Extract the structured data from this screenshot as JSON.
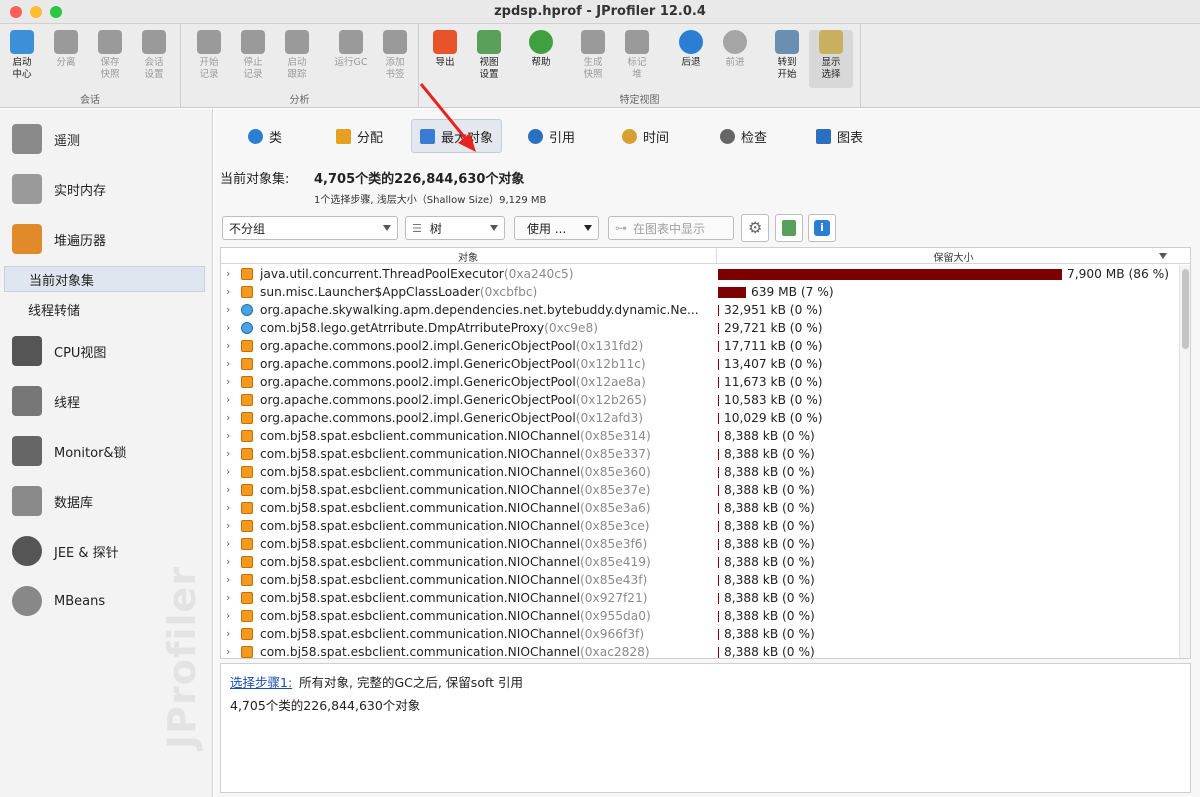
{
  "window": {
    "title": "zpdsp.hprof - JProfiler 12.0.4"
  },
  "toolbar": {
    "groups": [
      {
        "label": "会话",
        "buttons": [
          {
            "label": "启动\n中心",
            "icon": "launch-center-icon",
            "enabled": true
          },
          {
            "label": "分离",
            "icon": "detach-icon",
            "enabled": false
          },
          {
            "label": "保存\n快照",
            "icon": "save-snapshot-icon",
            "enabled": false
          },
          {
            "label": "会话\n设置",
            "icon": "session-settings-icon",
            "enabled": false
          }
        ]
      },
      {
        "label": "分析",
        "buttons": [
          {
            "label": "开始\n记录",
            "icon": "start-recording-icon",
            "enabled": false
          },
          {
            "label": "停止\n记录",
            "icon": "stop-recording-icon",
            "enabled": false
          },
          {
            "label": "启动\n跟踪",
            "icon": "start-tracking-icon",
            "enabled": false
          },
          {
            "label": "运行GC",
            "icon": "run-gc-icon",
            "enabled": false
          },
          {
            "label": "添加\n书签",
            "icon": "add-bookmark-icon",
            "enabled": false
          }
        ]
      },
      {
        "label": "特定视图",
        "buttons": [
          {
            "label": "导出",
            "icon": "export-icon",
            "enabled": true
          },
          {
            "label": "视图\n设置",
            "icon": "view-settings-icon",
            "enabled": true
          },
          {
            "label": "帮助",
            "icon": "help-icon",
            "enabled": true
          },
          {
            "label": "生成\n快照",
            "icon": "take-snapshot-icon",
            "enabled": false
          },
          {
            "label": "标记\n堆",
            "icon": "mark-heap-icon",
            "enabled": false
          },
          {
            "label": "后退",
            "icon": "back-icon",
            "enabled": true
          },
          {
            "label": "前进",
            "icon": "forward-icon",
            "enabled": false
          },
          {
            "label": "转到\n开始",
            "icon": "go-home-icon",
            "enabled": true
          },
          {
            "label": "显示\n选择",
            "icon": "show-selection-icon",
            "enabled": true,
            "selected": true
          }
        ]
      }
    ]
  },
  "sidebar": {
    "items": [
      {
        "label": "遥测",
        "icon": "telemetry-icon"
      },
      {
        "label": "实时内存",
        "icon": "live-memory-icon"
      },
      {
        "label": "堆遍历器",
        "icon": "heap-walker-icon"
      },
      {
        "label": "当前对象集",
        "sub": true,
        "selected": true
      },
      {
        "label": "线程转储",
        "sub": true
      },
      {
        "label": "CPU视图",
        "icon": "cpu-views-icon"
      },
      {
        "label": "线程",
        "icon": "threads-icon"
      },
      {
        "label": "Monitor&锁",
        "icon": "monitor-lock-icon"
      },
      {
        "label": "数据库",
        "icon": "database-icon"
      },
      {
        "label": "JEE & 探针",
        "icon": "jee-probes-icon"
      },
      {
        "label": "MBeans",
        "icon": "mbeans-icon"
      }
    ],
    "watermark": "JProfiler"
  },
  "tabs": [
    {
      "label": "类",
      "icon": "class-icon",
      "color": "#2a7fd4"
    },
    {
      "label": "分配",
      "icon": "allocations-icon",
      "color": "#e8a020"
    },
    {
      "label": "最大对象",
      "icon": "biggest-objects-icon",
      "color": "#3a7bd5",
      "selected": true
    },
    {
      "label": "引用",
      "icon": "references-icon",
      "color": "#2a6fc0"
    },
    {
      "label": "时间",
      "icon": "time-icon",
      "color": "#d8a030"
    },
    {
      "label": "检查",
      "icon": "inspections-icon",
      "color": "#666666"
    },
    {
      "label": "图表",
      "icon": "graph-icon",
      "color": "#2a6fc0"
    }
  ],
  "summary": {
    "label": "当前对象集:",
    "value": "4,705个类的226,844,630个对象",
    "sub": "1个选择步骤, 浅层大小（Shallow Size）9,129 MB"
  },
  "controls": {
    "grouping": "不分组",
    "view_mode": "树",
    "use_button": "使用 ...",
    "show_in_graph": "在图表中显示"
  },
  "table": {
    "columns": [
      "对象",
      "保留大小"
    ],
    "rows": [
      {
        "name": "java.util.concurrent.ThreadPoolExecutor",
        "addr": "(0xa240c5)",
        "size": "7,900 MB (86 %)",
        "pct": 0.86,
        "kind": "object"
      },
      {
        "name": "sun.misc.Launcher$AppClassLoader",
        "addr": "(0xcbfbc)",
        "size": "639 MB (7 %)",
        "pct": 0.07,
        "kind": "object"
      },
      {
        "name": "org.apache.skywalking.apm.dependencies.net.bytebuddy.dynamic.Ne...",
        "addr": "",
        "size": "32,951 kB (0 %)",
        "pct": 0.0036,
        "kind": "class"
      },
      {
        "name": "com.bj58.lego.getAtrribute.DmpAtrributeProxy",
        "addr": "(0xc9e8)",
        "size": "29,721 kB (0 %)",
        "pct": 0.0032,
        "kind": "class"
      },
      {
        "name": "org.apache.commons.pool2.impl.GenericObjectPool",
        "addr": "(0x131fd2)",
        "size": "17,711 kB (0 %)",
        "pct": 0.0019,
        "kind": "object"
      },
      {
        "name": "org.apache.commons.pool2.impl.GenericObjectPool",
        "addr": "(0x12b11c)",
        "size": "13,407 kB (0 %)",
        "pct": 0.0015,
        "kind": "object"
      },
      {
        "name": "org.apache.commons.pool2.impl.GenericObjectPool",
        "addr": "(0x12ae8a)",
        "size": "11,673 kB (0 %)",
        "pct": 0.0013,
        "kind": "object"
      },
      {
        "name": "org.apache.commons.pool2.impl.GenericObjectPool",
        "addr": "(0x12b265)",
        "size": "10,583 kB (0 %)",
        "pct": 0.0012,
        "kind": "object"
      },
      {
        "name": "org.apache.commons.pool2.impl.GenericObjectPool",
        "addr": "(0x12afd3)",
        "size": "10,029 kB (0 %)",
        "pct": 0.0011,
        "kind": "object"
      },
      {
        "name": "com.bj58.spat.esbclient.communication.NIOChannel",
        "addr": "(0x85e314)",
        "size": "8,388 kB (0 %)",
        "pct": 0.0009,
        "kind": "object"
      },
      {
        "name": "com.bj58.spat.esbclient.communication.NIOChannel",
        "addr": "(0x85e337)",
        "size": "8,388 kB (0 %)",
        "pct": 0.0009,
        "kind": "object"
      },
      {
        "name": "com.bj58.spat.esbclient.communication.NIOChannel",
        "addr": "(0x85e360)",
        "size": "8,388 kB (0 %)",
        "pct": 0.0009,
        "kind": "object"
      },
      {
        "name": "com.bj58.spat.esbclient.communication.NIOChannel",
        "addr": "(0x85e37e)",
        "size": "8,388 kB (0 %)",
        "pct": 0.0009,
        "kind": "object"
      },
      {
        "name": "com.bj58.spat.esbclient.communication.NIOChannel",
        "addr": "(0x85e3a6)",
        "size": "8,388 kB (0 %)",
        "pct": 0.0009,
        "kind": "object"
      },
      {
        "name": "com.bj58.spat.esbclient.communication.NIOChannel",
        "addr": "(0x85e3ce)",
        "size": "8,388 kB (0 %)",
        "pct": 0.0009,
        "kind": "object"
      },
      {
        "name": "com.bj58.spat.esbclient.communication.NIOChannel",
        "addr": "(0x85e3f6)",
        "size": "8,388 kB (0 %)",
        "pct": 0.0009,
        "kind": "object"
      },
      {
        "name": "com.bj58.spat.esbclient.communication.NIOChannel",
        "addr": "(0x85e419)",
        "size": "8,388 kB (0 %)",
        "pct": 0.0009,
        "kind": "object"
      },
      {
        "name": "com.bj58.spat.esbclient.communication.NIOChannel",
        "addr": "(0x85e43f)",
        "size": "8,388 kB (0 %)",
        "pct": 0.0009,
        "kind": "object"
      },
      {
        "name": "com.bj58.spat.esbclient.communication.NIOChannel",
        "addr": "(0x927f21)",
        "size": "8,388 kB (0 %)",
        "pct": 0.0009,
        "kind": "object"
      },
      {
        "name": "com.bj58.spat.esbclient.communication.NIOChannel",
        "addr": "(0x955da0)",
        "size": "8,388 kB (0 %)",
        "pct": 0.0009,
        "kind": "object"
      },
      {
        "name": "com.bj58.spat.esbclient.communication.NIOChannel",
        "addr": "(0x966f3f)",
        "size": "8,388 kB (0 %)",
        "pct": 0.0009,
        "kind": "object"
      },
      {
        "name": "com.bj58.spat.esbclient.communication.NIOChannel",
        "addr": "(0xac2828)",
        "size": "8,388 kB (0 %)",
        "pct": 0.0009,
        "kind": "object"
      }
    ]
  },
  "info": {
    "link": "选择步骤1:",
    "text": "所有对象, 完整的GC之后, 保留soft 引用",
    "line2": "4,705个类的226,844,630个对象"
  },
  "colors": {
    "bar": "#7c0000",
    "annotation_arrow": "#e8231b"
  }
}
